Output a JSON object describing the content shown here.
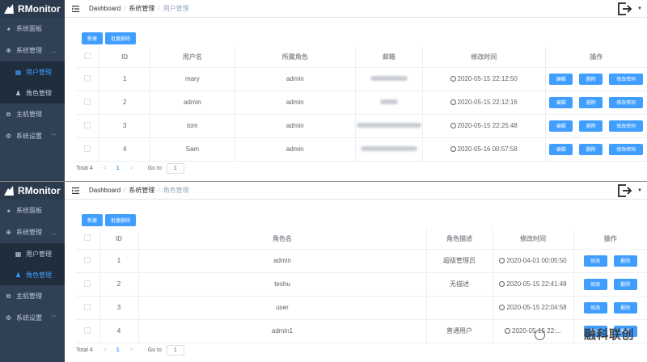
{
  "app": {
    "title": "RMonitor"
  },
  "menu": {
    "dashboard": "系统面板",
    "system": "系统管理",
    "user_mgmt": "用户管理",
    "role_mgmt": "角色管理",
    "host_mgmt": "主机管理",
    "settings": "系统设置"
  },
  "breadcrumb": {
    "home": "Dashboard",
    "system": "系统管理",
    "sep": "/"
  },
  "toolbar": {
    "add": "新建",
    "batch_delete": "批量删除"
  },
  "users_panel": {
    "breadcrumb_current": "用户管理",
    "columns": [
      "ID",
      "用户名",
      "所属角色",
      "邮箱",
      "修改时间",
      "操作"
    ],
    "rows": [
      {
        "id": "1",
        "username": "mary",
        "role": "admin",
        "email": "(redacted)",
        "modified": "2020-05-15 22:12:50"
      },
      {
        "id": "2",
        "username": "admin",
        "role": "admin",
        "email": "(redacted)",
        "modified": "2020-05-15 22:12:16"
      },
      {
        "id": "3",
        "username": "tom",
        "role": "admin",
        "email": "(redacted)",
        "modified": "2020-05-15 22:25:48"
      },
      {
        "id": "4",
        "username": "Sam",
        "role": "admin",
        "email": "(redacted)",
        "modified": "2020-05-16 00:57:58"
      }
    ],
    "actions": {
      "edit": "编辑",
      "delete": "删除",
      "change_password": "修改密码"
    }
  },
  "roles_panel": {
    "breadcrumb_current": "角色管理",
    "columns": [
      "ID",
      "角色名",
      "角色描述",
      "修改时间",
      "操作"
    ],
    "rows": [
      {
        "id": "1",
        "name": "admin",
        "desc": "超级管理员",
        "modified": "2020-04-01 00:05:50"
      },
      {
        "id": "2",
        "name": "teshu",
        "desc": "无描述",
        "modified": "2020-05-15 22:41:48"
      },
      {
        "id": "3",
        "name": "user",
        "desc": "",
        "modified": "2020-05-15 22:04:58"
      },
      {
        "id": "4",
        "name": "admin1",
        "desc": "普通用户",
        "modified": "2020-05-15 22:..."
      }
    ],
    "actions": {
      "edit": "修改",
      "delete": "删除"
    }
  },
  "pager": {
    "total": "Total 4",
    "prev": "<",
    "next": ">",
    "page": "1",
    "goto": "Go to",
    "goto_value": "1"
  },
  "watermark": "融科联创",
  "colors": {
    "sidebar": "#304156",
    "accent": "#409eff",
    "menu_text": "#bfcbd9"
  }
}
